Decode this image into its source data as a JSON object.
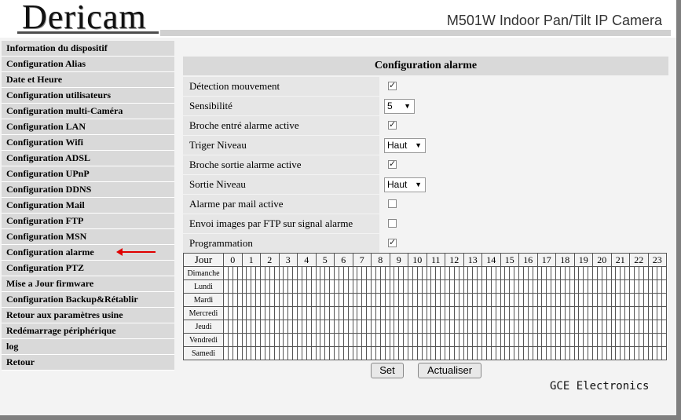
{
  "header": {
    "logo": "Dericam",
    "model": "M501W Indoor Pan/Tilt  IP Camera"
  },
  "sidebar": {
    "items": [
      {
        "label": "Information du dispositif"
      },
      {
        "label": "Configuration Alias"
      },
      {
        "label": "Date et Heure"
      },
      {
        "label": "Configuration utilisateurs"
      },
      {
        "label": "Configuration multi-Caméra"
      },
      {
        "label": "Configuration LAN"
      },
      {
        "label": "Configuration Wifi"
      },
      {
        "label": "Configuration ADSL"
      },
      {
        "label": "Configuration UPnP"
      },
      {
        "label": "Configuration DDNS"
      },
      {
        "label": "Configuration Mail"
      },
      {
        "label": "Configuration FTP"
      },
      {
        "label": "Configuration MSN"
      },
      {
        "label": "Configuration alarme"
      },
      {
        "label": "Configuration PTZ"
      },
      {
        "label": "Mise a Jour firmware"
      },
      {
        "label": "Configuration Backup&Rétablir"
      },
      {
        "label": "Retour aux paramètres usine"
      },
      {
        "label": "Redémarrage périphérique"
      },
      {
        "label": "log"
      },
      {
        "label": "Retour"
      }
    ]
  },
  "panel": {
    "title": "Configuration alarme",
    "rows": [
      {
        "label": "Détection mouvement",
        "type": "checkbox",
        "checked": true
      },
      {
        "label": "Sensibilité",
        "type": "select",
        "value": "5"
      },
      {
        "label": "Broche entré alarme active",
        "type": "checkbox",
        "checked": true
      },
      {
        "label": "Triger Niveau",
        "type": "select",
        "value": "Haut"
      },
      {
        "label": "Broche sortie alarme active",
        "type": "checkbox",
        "checked": true
      },
      {
        "label": "Sortie Niveau",
        "type": "select",
        "value": "Haut"
      },
      {
        "label": "Alarme par mail active",
        "type": "checkbox",
        "checked": false
      },
      {
        "label": "Envoi images par FTP sur signal alarme",
        "type": "checkbox",
        "checked": false
      },
      {
        "label": "Programmation",
        "type": "checkbox",
        "checked": true
      }
    ]
  },
  "schedule": {
    "header": "Jour",
    "hours": [
      "0",
      "1",
      "2",
      "3",
      "4",
      "5",
      "6",
      "7",
      "8",
      "9",
      "10",
      "11",
      "12",
      "13",
      "14",
      "15",
      "16",
      "17",
      "18",
      "19",
      "20",
      "21",
      "22",
      "23"
    ],
    "days": [
      "Dimanche",
      "Lundi",
      "Mardi",
      "Mercredi",
      "Jeudi",
      "Vendredi",
      "Samedi"
    ]
  },
  "buttons": {
    "set": "Set",
    "refresh": "Actualiser"
  },
  "footer": "GCE Electronics"
}
